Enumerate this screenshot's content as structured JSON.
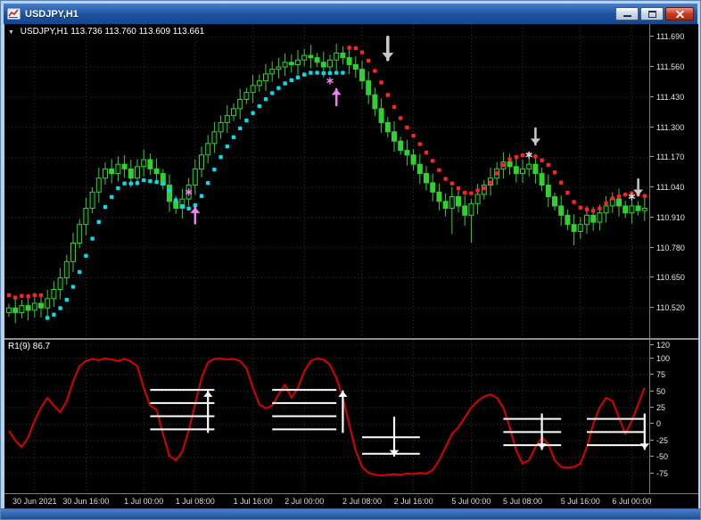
{
  "window": {
    "title": "USDJPY,H1",
    "controls": {
      "minimize": "minimize",
      "restore": "restore",
      "close": "close"
    }
  },
  "chart": {
    "info_label": {
      "dropdown_glyph": "▼",
      "symbol": "USDJPY,H1",
      "ohlc": "113.736 113.760 113.609 113.661"
    },
    "price_axis_labels": [
      "111.690",
      "111.560",
      "111.430",
      "111.300",
      "111.170",
      "111.040",
      "110.910",
      "110.780",
      "110.650",
      "110.520"
    ],
    "time_axis_labels": [
      "30 Jun 2021",
      "30 Jun 16:00",
      "1 Jul 00:00",
      "1 Jul 08:00",
      "1 Jul 16:00",
      "2 Jul 00:00",
      "2 Jul 08:00",
      "2 Jul 16:00",
      "5 Jul 00:00",
      "5 Jul 08:00",
      "5 Jul 16:00",
      "6 Jul 00:00"
    ],
    "colors": {
      "background": "#000000",
      "grid": "#333333",
      "candle": "#2fd32f",
      "bull_fill": "#001400",
      "bear_fill": "#2fd32f",
      "up_dots": "#00dfe8",
      "down_dots": "#ff2222",
      "up_arrow": "#f080f0",
      "down_arrow": "#c9c9c9",
      "oscillator_line": "#d90000",
      "signal_marks": "#ffffff"
    }
  },
  "indicator": {
    "label": "R1(9) 86.7",
    "axis_labels": [
      120,
      100,
      75,
      50,
      25,
      0,
      -25,
      -50,
      -75
    ]
  },
  "chart_data": {
    "type": "candlestick_with_oscillator",
    "symbol": "USDJPY",
    "timeframe": "H1",
    "price_range": [
      110.39,
      111.745
    ],
    "oscillator_range": [
      -105,
      128
    ],
    "bars_closes": [
      110.52,
      110.5,
      110.53,
      110.51,
      110.54,
      110.52,
      110.56,
      110.6,
      110.65,
      110.72,
      110.8,
      110.88,
      110.95,
      111.02,
      111.08,
      111.12,
      111.1,
      111.14,
      111.12,
      111.08,
      111.13,
      111.16,
      111.12,
      111.1,
      111.05,
      110.98,
      110.95,
      110.99,
      111.05,
      111.12,
      111.18,
      111.23,
      111.28,
      111.32,
      111.35,
      111.38,
      111.42,
      111.45,
      111.48,
      111.5,
      111.53,
      111.55,
      111.56,
      111.58,
      111.57,
      111.59,
      111.61,
      111.6,
      111.58,
      111.56,
      111.59,
      111.62,
      111.6,
      111.57,
      111.55,
      111.5,
      111.44,
      111.38,
      111.32,
      111.28,
      111.24,
      111.2,
      111.18,
      111.14,
      111.1,
      111.06,
      111.02,
      110.98,
      110.95,
      111.0,
      110.96,
      110.92,
      110.97,
      111.01,
      111.05,
      111.08,
      111.12,
      111.15,
      111.13,
      111.1,
      111.12,
      111.14,
      111.1,
      111.05,
      111.0,
      110.96,
      110.92,
      110.88,
      110.85,
      110.88,
      110.92,
      110.89,
      110.93,
      110.96,
      110.99,
      110.96,
      110.93,
      110.96,
      110.94,
      110.95
    ],
    "wick_overrides": [
      {
        "bar": 51,
        "high": 111.66
      },
      {
        "bar": 69,
        "low": 110.84
      },
      {
        "bar": 72,
        "low": 110.8
      },
      {
        "bar": 88,
        "low": 110.79
      }
    ],
    "trend_dots": [
      {
        "start": 0,
        "end": 5,
        "color": "red"
      },
      {
        "start": 6,
        "end": 52,
        "color": "cyan"
      },
      {
        "start": 53,
        "end": 99,
        "color": "red"
      }
    ],
    "arrows": [
      {
        "bar": 29,
        "dir": "up",
        "price": 110.92,
        "color": "#f080f0",
        "size": 1
      },
      {
        "bar": 51,
        "dir": "up",
        "price": 111.43,
        "color": "#f080f0",
        "size": 1
      },
      {
        "bar": 59,
        "dir": "down",
        "price": 111.64,
        "color": "#c9c9c9",
        "size": 1.4
      },
      {
        "bar": 82,
        "dir": "down",
        "price": 111.26,
        "color": "#c9c9c9",
        "size": 1
      },
      {
        "bar": 98,
        "dir": "down",
        "price": 111.04,
        "color": "#c9c9c9",
        "size": 1
      }
    ],
    "stars": [
      {
        "bar": 28,
        "price": 111.02,
        "color": "#f080f0"
      },
      {
        "bar": 50,
        "price": 111.5,
        "color": "#f080f0"
      },
      {
        "bar": 81,
        "price": 111.18,
        "color": "#dcdcdc"
      },
      {
        "bar": 97,
        "price": 111.0,
        "color": "#dcdcdc"
      }
    ],
    "oscillator_values": [
      -10,
      -25,
      -35,
      -20,
      5,
      25,
      40,
      28,
      18,
      35,
      65,
      88,
      96,
      99,
      97,
      100,
      98,
      96,
      99,
      95,
      88,
      55,
      28,
      22,
      -15,
      -48,
      -55,
      -42,
      -10,
      30,
      70,
      94,
      99,
      100,
      98,
      99,
      96,
      85,
      55,
      30,
      24,
      28,
      45,
      60,
      40,
      55,
      80,
      96,
      100,
      98,
      90,
      70,
      40,
      0,
      -40,
      -65,
      -74,
      -77,
      -78,
      -77,
      -76,
      -77,
      -75,
      -76,
      -74,
      -75,
      -70,
      -55,
      -35,
      -15,
      -5,
      10,
      25,
      35,
      42,
      45,
      40,
      25,
      -5,
      -40,
      -60,
      -55,
      -35,
      -20,
      -30,
      -55,
      -65,
      -66,
      -65,
      -60,
      -35,
      0,
      25,
      40,
      35,
      10,
      -15,
      5,
      30,
      55
    ],
    "oscillator_signals": [
      {
        "from_bar": 22,
        "to_bar": 32,
        "levels": [
          52,
          32,
          12,
          -8
        ],
        "arrow": {
          "bar": 31,
          "dir": "up",
          "v1": -12,
          "v2": 50
        }
      },
      {
        "from_bar": 41,
        "to_bar": 51,
        "levels": [
          52,
          32,
          12,
          -8
        ],
        "arrow": {
          "bar": 52,
          "dir": "up",
          "v1": -12,
          "v2": 50
        }
      },
      {
        "from_bar": 55,
        "to_bar": 64,
        "levels": [
          -20,
          -45
        ],
        "arrow": {
          "bar": 60,
          "dir": "down",
          "v1": 10,
          "v2": -48
        }
      },
      {
        "from_bar": 77,
        "to_bar": 86,
        "levels": [
          8,
          -12,
          -32
        ],
        "arrow": {
          "bar": 83,
          "dir": "down",
          "v1": 15,
          "v2": -38
        }
      },
      {
        "from_bar": 90,
        "to_bar": 99,
        "levels": [
          8,
          -12,
          -32
        ],
        "arrow": {
          "bar": 99,
          "dir": "down",
          "v1": 15,
          "v2": -38
        }
      }
    ]
  }
}
